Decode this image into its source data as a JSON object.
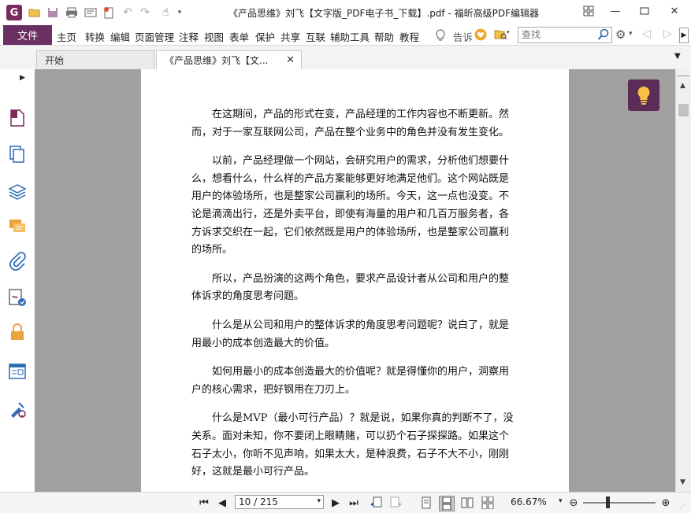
{
  "window": {
    "title": "《产品思维》刘飞【文字版_PDF电子书_下载】.pdf - 福昕高级PDF编辑器",
    "logo_letter": "G"
  },
  "menu": {
    "file": "文件",
    "items": [
      "主页",
      "转换",
      "编辑",
      "页面管理",
      "注释",
      "视图",
      "表单",
      "保护",
      "共享",
      "互联",
      "辅助工具",
      "帮助",
      "教程"
    ],
    "tell_me": "告诉",
    "search_placeholder": "查找"
  },
  "tabs": [
    {
      "label": "开始"
    },
    {
      "label": "《产品思维》刘飞【文...",
      "close": "✕"
    }
  ],
  "sidebar_icons": [
    "page-thumbnails-icon",
    "copy-pages-icon",
    "layers-icon",
    "comments-icon",
    "attachments-icon",
    "signature-icon",
    "security-lock-icon",
    "form-fields-icon",
    "destinations-icon"
  ],
  "document": {
    "paragraphs": [
      "在这期间，产品的形式在变，产品经理的工作内容也不断更新。然而，对于一家互联网公司，产品在整个业务中的角色并没有发生变化。",
      "以前，产品经理做一个网站，会研究用户的需求，分析他们想要什么，想看什么，什么样的产品方案能够更好地满足他们。这个网站既是用户的体验场所，也是整家公司赢利的场所。今天，这一点也没变。不论是滴滴出行，还是外卖平台，即使有海量的用户和几百万服务者，各方诉求交织在一起，它们依然既是用户的体验场所，也是整家公司赢利的场所。",
      "所以，产品扮演的这两个角色，要求产品设计者从公司和用户的整体诉求的角度思考问题。",
      "什么是从公司和用户的整体诉求的角度思考问题呢？说白了，就是用最小的成本创造最大的价值。",
      "如何用最小的成本创造最大的价值呢？就是得懂你的用户，洞察用户的核心需求，把好钢用在刀刃上。",
      "什么是MVP（最小可行产品）？就是说，如果你真的判断不了，没关系。面对未知，你不要闭上眼睛赌，可以扔个石子探探路。如果这个石子太小，你听不见声响，如果太大，是种浪费，石子不大不小，刚刚好，这就是最小可行产品。"
    ]
  },
  "statusbar": {
    "page_display": "10 / 215",
    "zoom": "66.67%",
    "zoom_level": 0.32
  },
  "colors": {
    "brand": "#6b2f62",
    "doc_background": "#a0a0a0",
    "sidebar_icon_blue": "#2b6cb5",
    "sidebar_icon_orange": "#e8a33a",
    "sidebar_icon_purple": "#7a2b5e"
  }
}
